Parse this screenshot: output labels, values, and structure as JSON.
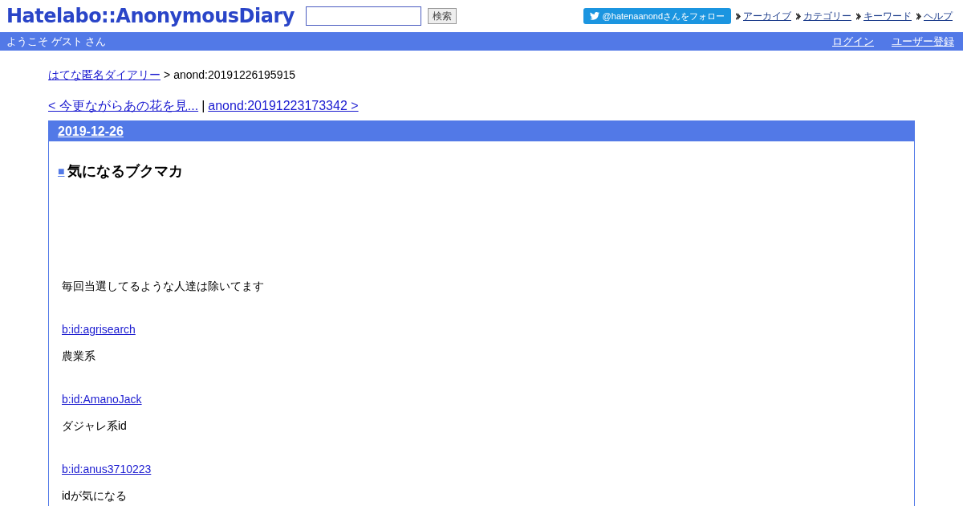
{
  "header": {
    "logo": "Hatelabo::AnonymousDiary",
    "search": {
      "button": "検索"
    },
    "follow": "@hatenaanondさんをフォロー",
    "nav": [
      "アーカイブ",
      "カテゴリー",
      "キーワード",
      "ヘルプ"
    ]
  },
  "welcome_bar": {
    "greeting": "ようこそ ゲスト さん",
    "links": [
      "ログイン",
      "ユーザー登録"
    ]
  },
  "breadcrumb": {
    "home": "はてな匿名ダイアリー",
    "separator": ">",
    "current": "anond:20191226195915"
  },
  "pager": {
    "prev": "< 今更ながらあの花を見...",
    "separator": "|",
    "next": "anond:20191223173342 >"
  },
  "entry": {
    "date": "2019-12-26",
    "title_mark": "■",
    "title": "気になるブクマカ",
    "blocks": [
      {
        "kind": "text",
        "text": "毎回当選してるような人達は除いてます"
      },
      {
        "kind": "link",
        "text": "b:id:agrisearch"
      },
      {
        "kind": "text",
        "text": "農業系"
      },
      {
        "kind": "link",
        "text": "b:id:AmanoJack"
      },
      {
        "kind": "text",
        "text": "ダジャレ系id"
      },
      {
        "kind": "link",
        "text": "b:id:anus3710223"
      },
      {
        "kind": "text",
        "text": "idが気になる"
      }
    ]
  }
}
